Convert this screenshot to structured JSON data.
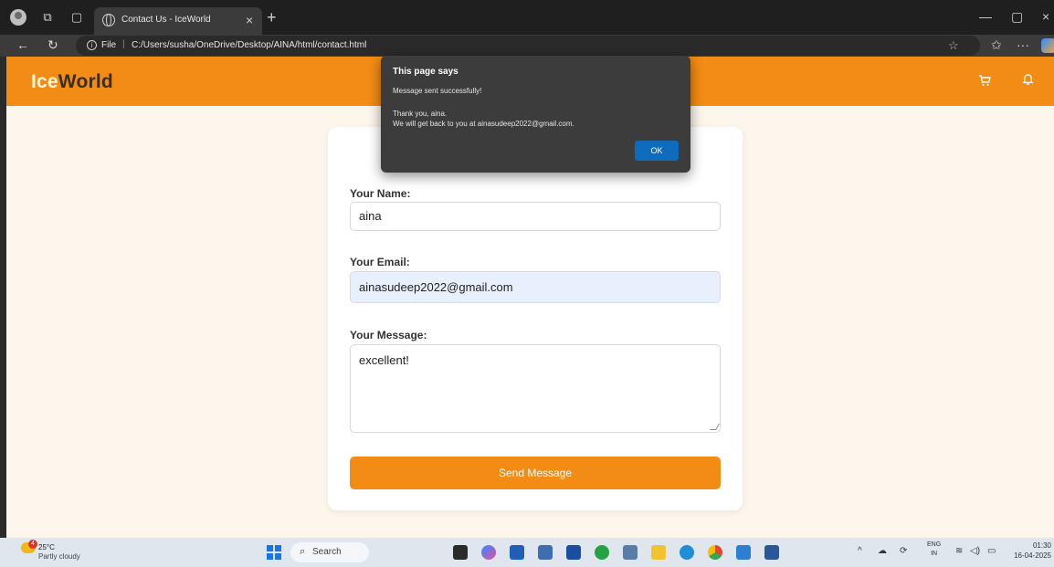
{
  "browser": {
    "tab_title": "Contact Us - IceWorld",
    "file_label": "File",
    "url": "C:/Users/susha/OneDrive/Desktop/AINA/html/contact.html"
  },
  "site": {
    "logo_part1": "Ice",
    "logo_part2": "World"
  },
  "form": {
    "name_label": "Your Name:",
    "name_value": "aina",
    "email_label": "Your Email:",
    "email_value": "ainasudeep2022@gmail.com",
    "message_label": "Your Message:",
    "message_value": "excellent!",
    "submit_label": "Send Message"
  },
  "dialog": {
    "title": "This page says",
    "line1": "Message sent successfully!",
    "line2": "Thank you, aina.",
    "line3": "We will get back to you at ainasudeep2022@gmail.com.",
    "ok_label": "OK"
  },
  "taskbar": {
    "weather_badge": "4",
    "temperature": "25°C",
    "condition": "Partly cloudy",
    "search_label": "Search",
    "lang_line1": "ENG",
    "lang_line2": "IN",
    "time": "01:30",
    "date": "16-04-2025"
  },
  "colors": {
    "brand_orange": "#f28c14",
    "dialog_bg": "#3c3c3c",
    "ok_blue": "#0f6cbd",
    "autofill_blue": "#e8f0fe"
  }
}
